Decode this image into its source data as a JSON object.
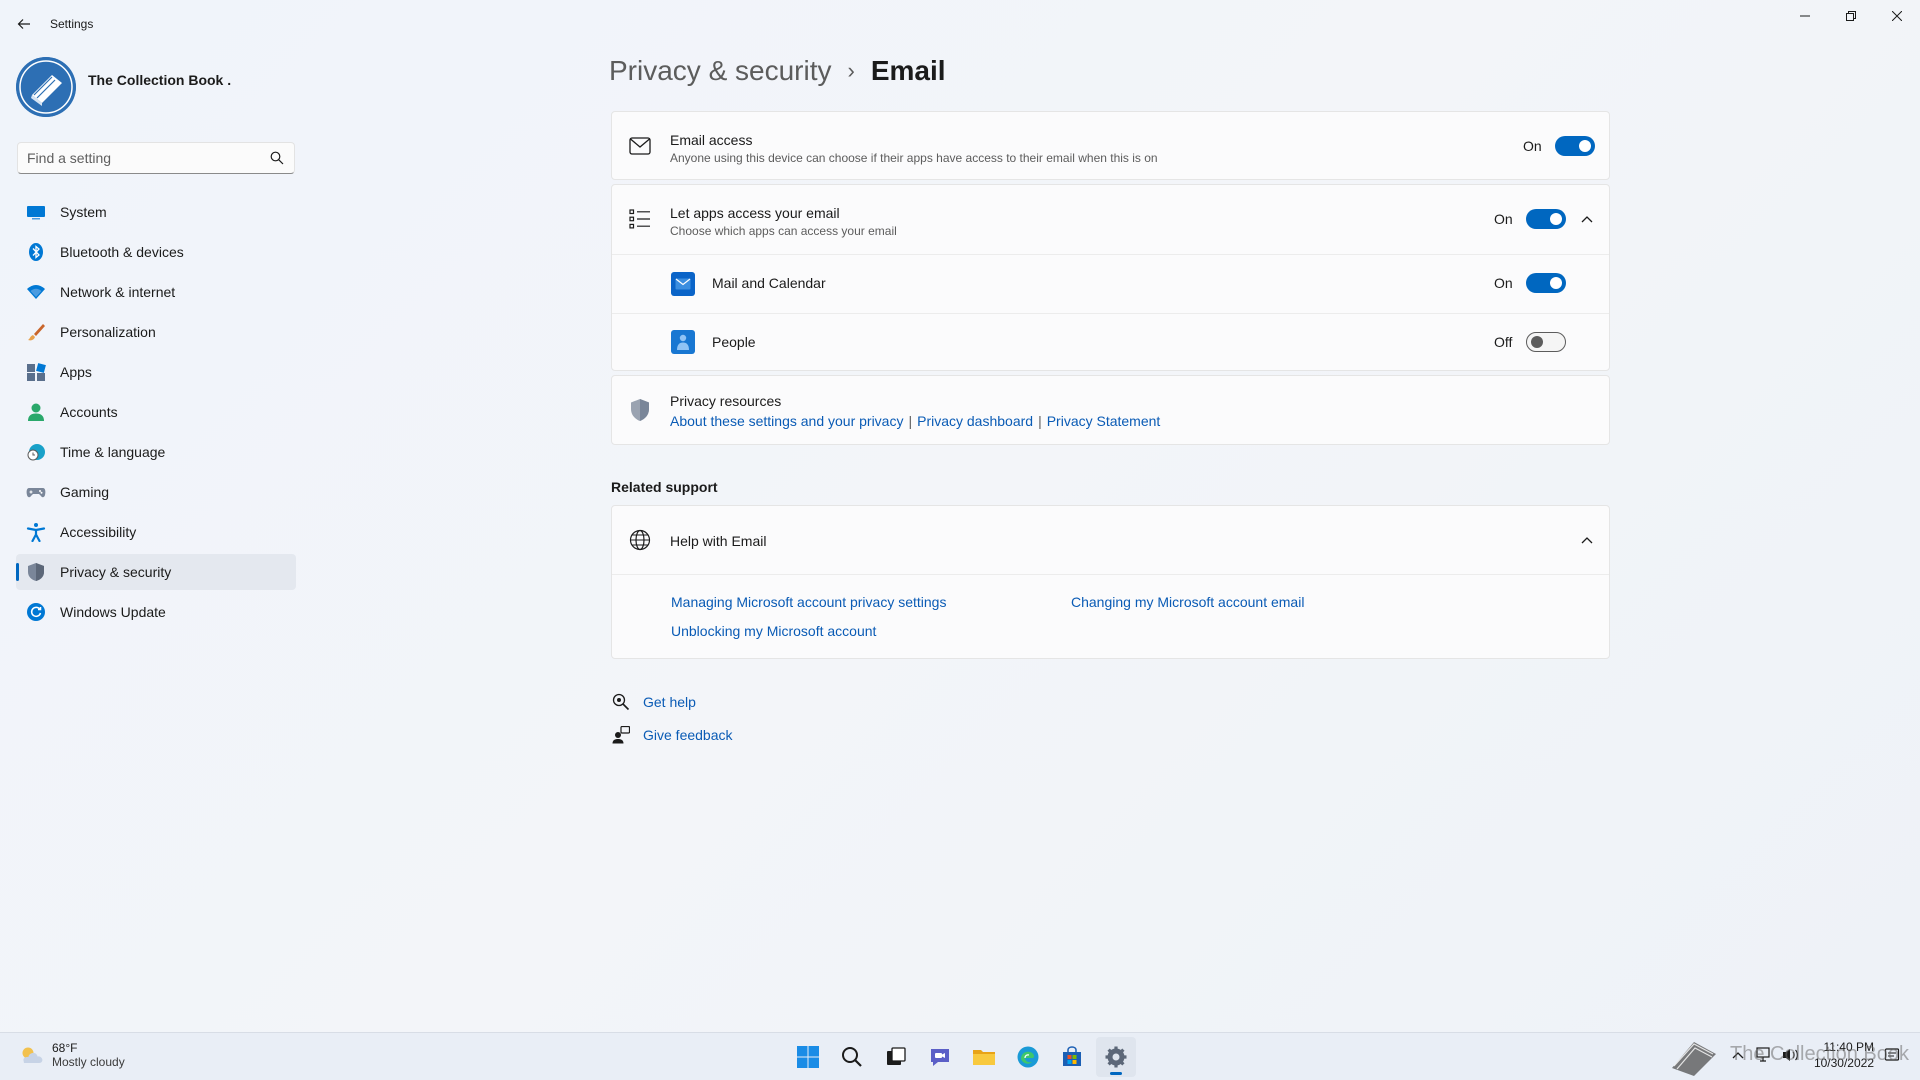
{
  "window": {
    "app_title": "Settings"
  },
  "profile": {
    "name": "The Collection Book ."
  },
  "search": {
    "placeholder": "Find a setting"
  },
  "sidebar": {
    "items": [
      {
        "label": "System",
        "icon": "system-icon"
      },
      {
        "label": "Bluetooth & devices",
        "icon": "bluetooth-icon"
      },
      {
        "label": "Network & internet",
        "icon": "wifi-icon"
      },
      {
        "label": "Personalization",
        "icon": "brush-icon"
      },
      {
        "label": "Apps",
        "icon": "apps-icon"
      },
      {
        "label": "Accounts",
        "icon": "person-icon"
      },
      {
        "label": "Time & language",
        "icon": "clock-globe-icon"
      },
      {
        "label": "Gaming",
        "icon": "gamepad-icon"
      },
      {
        "label": "Accessibility",
        "icon": "accessibility-icon"
      },
      {
        "label": "Privacy & security",
        "icon": "shield-icon",
        "active": true
      },
      {
        "label": "Windows Update",
        "icon": "update-icon"
      }
    ]
  },
  "breadcrumb": {
    "parent": "Privacy & security",
    "separator": "›",
    "current": "Email"
  },
  "email_access": {
    "title": "Email access",
    "subtitle": "Anyone using this device can choose if their apps have access to their email when this is on",
    "state": "On"
  },
  "let_apps": {
    "title": "Let apps access your email",
    "subtitle": "Choose which apps can access your email",
    "state": "On",
    "apps": [
      {
        "name": "Mail and Calendar",
        "state": "On",
        "icon": "mail-calendar-app-icon"
      },
      {
        "name": "People",
        "state": "Off",
        "icon": "people-app-icon"
      }
    ]
  },
  "privacy_resources": {
    "title": "Privacy resources",
    "links": [
      "About these settings and your privacy",
      "Privacy dashboard",
      "Privacy Statement"
    ],
    "separator": "|"
  },
  "related_support": {
    "heading": "Related support",
    "help_title": "Help with Email",
    "links": [
      "Managing Microsoft account privacy settings",
      "Changing my Microsoft account email",
      "Unblocking my Microsoft account"
    ]
  },
  "footer": {
    "get_help": "Get help",
    "give_feedback": "Give feedback"
  },
  "taskbar": {
    "weather_temp": "68°F",
    "weather_desc": "Mostly cloudy",
    "time": "11:40 PM",
    "date": "10/30/2022",
    "watermark": "The Collection Book"
  },
  "colors": {
    "accent": "#0067c0",
    "link": "#0a5bb5"
  }
}
